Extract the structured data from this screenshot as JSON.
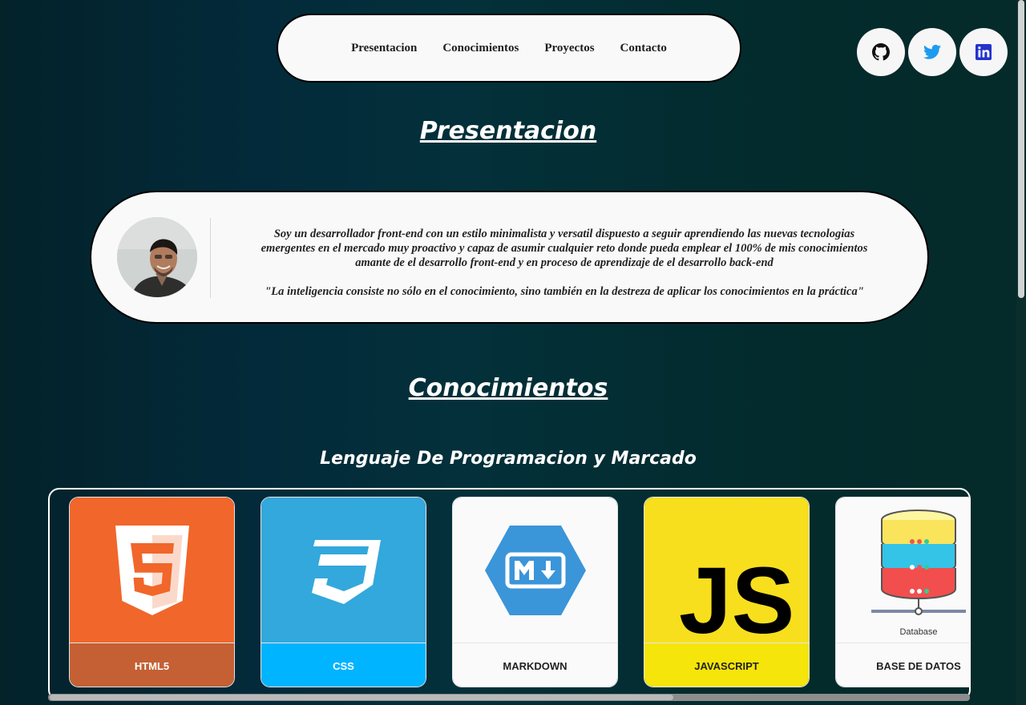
{
  "nav": {
    "items": [
      {
        "label": "Presentacion"
      },
      {
        "label": "Conocimientos"
      },
      {
        "label": "Proyectos"
      },
      {
        "label": "Contacto"
      }
    ]
  },
  "social": [
    {
      "name": "github",
      "icon": "github-icon",
      "color": "#000000"
    },
    {
      "name": "twitter",
      "icon": "twitter-icon",
      "color": "#1d9bf0"
    },
    {
      "name": "linkedin",
      "icon": "linkedin-icon",
      "color": "#2233cc"
    }
  ],
  "presentacion": {
    "title": "Presentacion",
    "paragraph_lines": [
      "Soy un desarrollador front-end con un estilo minimalista y versatil dispuesto a seguir aprendiendo las nuevas tecnologias",
      "emergentes en el mercado muy proactivo y capaz de asumir cualquier reto donde pueda emplear el 100% de mis conocimientos",
      "amante de el desarrollo front-end y en proceso de aprendizaje de el desarrollo back-end"
    ],
    "quote": "\"La inteligencia consiste no sólo en el conocimiento, sino también en la destreza de aplicar los conocimientos en la práctica\""
  },
  "conocimientos": {
    "title": "Conocimientos",
    "subtitle": "Lenguaje De Programacion y Marcado",
    "cards": [
      {
        "label": "HTML5",
        "icon": "html5-icon",
        "bg": "#f1662a",
        "label_bg": "#c46034",
        "label_color": "#ffffff"
      },
      {
        "label": "CSS",
        "icon": "css3-icon",
        "bg": "#33a8dc",
        "label_bg": "#00b4ff",
        "label_color": "#ffffff"
      },
      {
        "label": "MARKDOWN",
        "icon": "markdown-icon",
        "bg": "#fafafa",
        "label_bg": "#fafafa",
        "label_color": "#222222"
      },
      {
        "label": "JAVASCRIPT",
        "icon": "javascript-icon",
        "bg": "#f7df1e",
        "label_bg": "#f5e50a",
        "label_color": "#222222"
      },
      {
        "label": "BASE DE DATOS",
        "icon": "database-icon",
        "icon_caption": "Database",
        "bg": "#fafafa",
        "label_bg": "#fafafa",
        "label_color": "#222222"
      }
    ]
  }
}
